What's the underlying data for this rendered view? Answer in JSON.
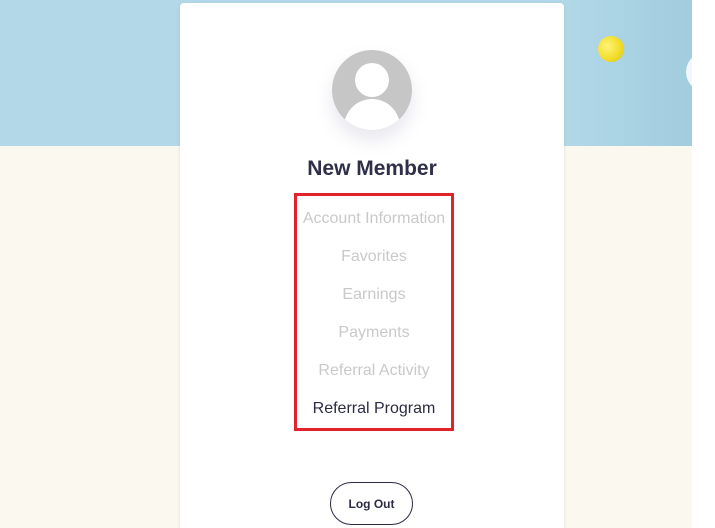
{
  "profile": {
    "name": "New Member",
    "avatar_icon": "user-silhouette-icon"
  },
  "menu": {
    "items": [
      {
        "label": "Account Information",
        "active": false
      },
      {
        "label": "Favorites",
        "active": false
      },
      {
        "label": "Earnings",
        "active": false
      },
      {
        "label": "Payments",
        "active": false
      },
      {
        "label": "Referral Activity",
        "active": false
      },
      {
        "label": "Referral Program",
        "active": true
      }
    ]
  },
  "actions": {
    "logout_label": "Log Out"
  },
  "colors": {
    "banner": "#b3d9e8",
    "page_background": "#fbf9ef",
    "highlight": "#e0242c",
    "text_dark": "#2b2b45",
    "text_muted": "#c9c9c9"
  }
}
